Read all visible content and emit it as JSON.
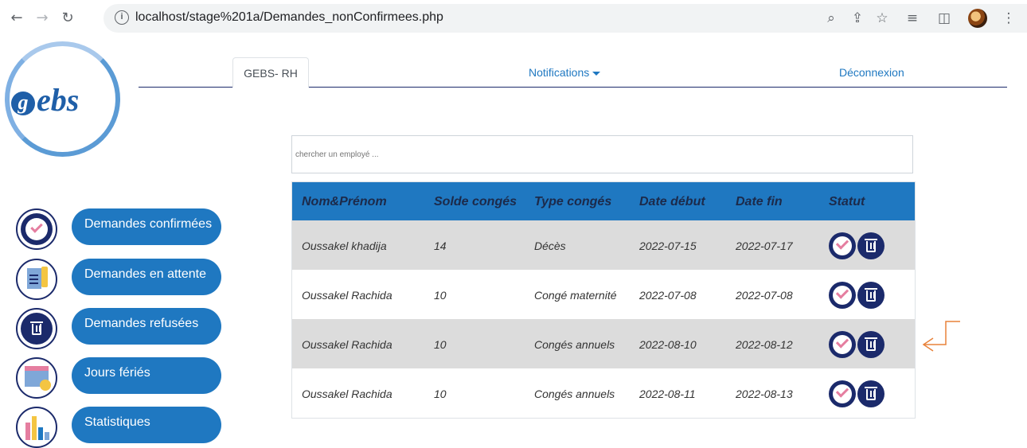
{
  "browser": {
    "url_host": "localhost",
    "url_path": "/stage%201a/Demandes_nonConfirmees.php"
  },
  "nav": {
    "brand_tab": "GEBS- RH",
    "notifications": "Notifications",
    "logout": "Déconnexion"
  },
  "logo": {
    "text": "ebs",
    "initial": "g"
  },
  "search": {
    "placeholder": "chercher un employé ..."
  },
  "table": {
    "headers": [
      "Nom&Prénom",
      "Solde congés",
      "Type congés",
      "Date début",
      "Date fin",
      "Statut"
    ],
    "rows": [
      {
        "name": "Oussakel khadija",
        "solde": "14",
        "type": "Décès",
        "debut": "2022-07-15",
        "fin": "2022-07-17"
      },
      {
        "name": "Oussakel Rachida",
        "solde": "10",
        "type": "Congé maternité",
        "debut": "2022-07-08",
        "fin": "2022-07-08"
      },
      {
        "name": "Oussakel Rachida",
        "solde": "10",
        "type": "Congés annuels",
        "debut": "2022-08-10",
        "fin": "2022-08-12"
      },
      {
        "name": "Oussakel Rachida",
        "solde": "10",
        "type": "Congés annuels",
        "debut": "2022-08-11",
        "fin": "2022-08-13"
      }
    ]
  },
  "sidebar": {
    "items": [
      {
        "label": "Demandes confirmées"
      },
      {
        "label": "Demandes en attente"
      },
      {
        "label": "Demandes refusées"
      },
      {
        "label": "Jours fériés"
      },
      {
        "label": "Statistiques"
      }
    ]
  },
  "colors": {
    "primary": "#1f78c1",
    "dark": "#1b2a6b",
    "row_grey": "#dcdcdc",
    "accent_pink": "#e57ea0",
    "arrow": "#e8823a"
  }
}
